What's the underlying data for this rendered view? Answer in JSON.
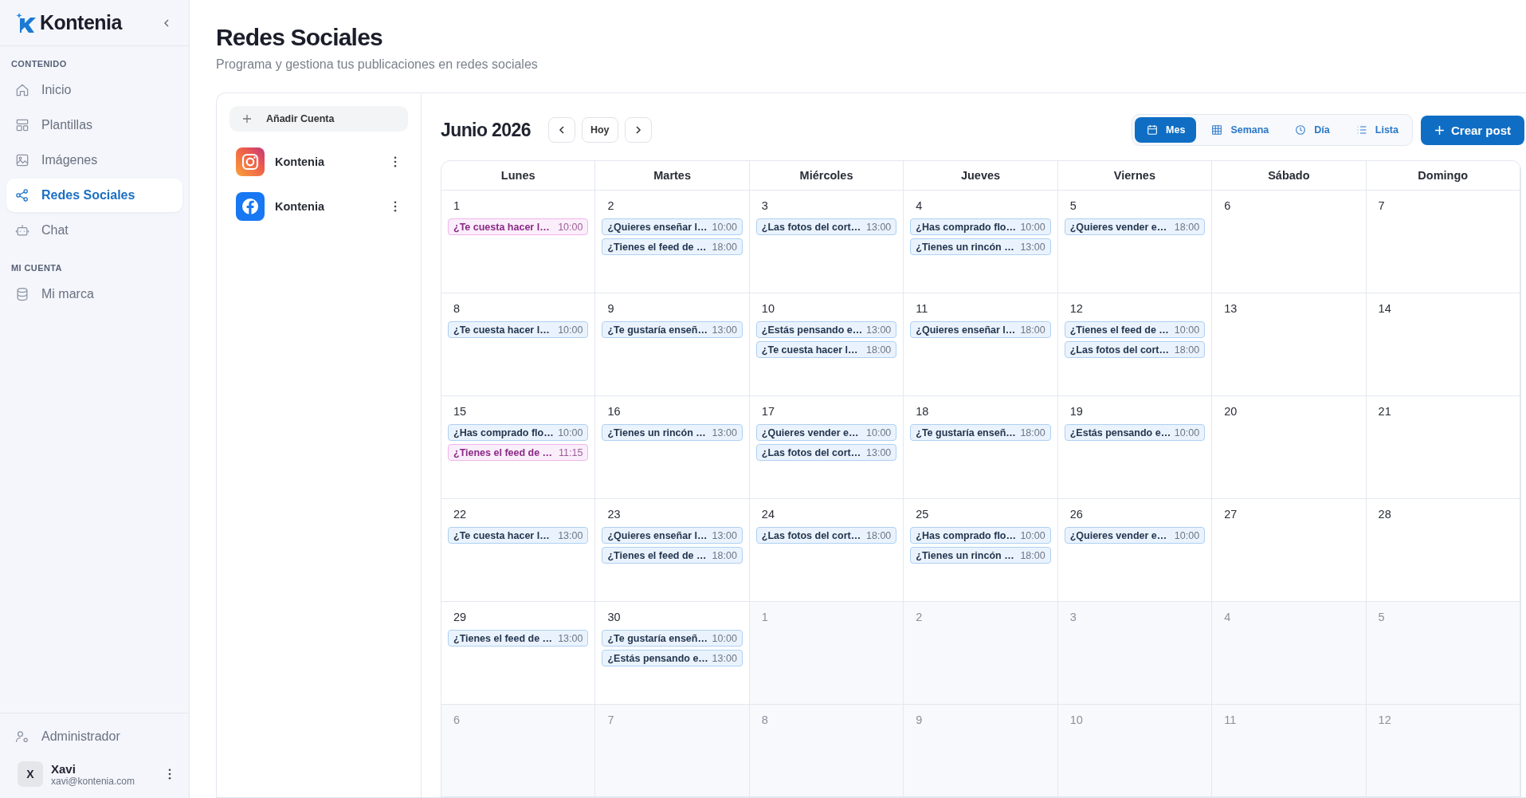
{
  "sidebar": {
    "brand": "Kontenia",
    "sections": [
      {
        "heading": "CONTENIDO",
        "items": [
          {
            "label": "Inicio",
            "selected": false
          },
          {
            "label": "Plantillas",
            "selected": false
          },
          {
            "label": "Imágenes",
            "selected": false
          },
          {
            "label": "Redes Sociales",
            "selected": true
          },
          {
            "label": "Chat",
            "selected": false
          }
        ]
      },
      {
        "heading": "MI CUENTA",
        "items": [
          {
            "label": "Mi marca",
            "selected": false
          }
        ]
      }
    ],
    "admin": "Administrador",
    "user": {
      "initial": "X",
      "name": "Xavi",
      "email": "xavi@kontenia.com"
    }
  },
  "page": {
    "title": "Redes Sociales",
    "subtitle": "Programa y gestiona tus publicaciones en redes sociales"
  },
  "accounts": {
    "add_label": "Añadir Cuenta",
    "items": [
      {
        "kind": "instagram",
        "name": "Kontenia"
      },
      {
        "kind": "facebook",
        "name": "Kontenia"
      }
    ]
  },
  "calendar": {
    "month": "Junio 2026",
    "today": "Hoy",
    "views": [
      {
        "label": "Mes",
        "selected": true
      },
      {
        "label": "Semana",
        "selected": false
      },
      {
        "label": "Día",
        "selected": false
      },
      {
        "label": "Lista",
        "selected": false
      }
    ],
    "create": "Crear post",
    "weekdays": [
      "Lunes",
      "Martes",
      "Miércoles",
      "Jueves",
      "Viernes",
      "Sábado",
      "Domingo"
    ],
    "weeks": [
      [
        {
          "day": "1",
          "other_month": false,
          "events": [
            {
              "title": "¿Te cuesta hacer l…",
              "time": "10:00",
              "kind": "instagram"
            }
          ]
        },
        {
          "day": "2",
          "other_month": false,
          "events": [
            {
              "title": "¿Quieres enseñar l…",
              "time": "10:00",
              "kind": "facebook"
            },
            {
              "title": "¿Tienes el feed de …",
              "time": "18:00",
              "kind": "facebook"
            }
          ]
        },
        {
          "day": "3",
          "other_month": false,
          "events": [
            {
              "title": "¿Las fotos del cort…",
              "time": "13:00",
              "kind": "facebook"
            }
          ]
        },
        {
          "day": "4",
          "other_month": false,
          "events": [
            {
              "title": "¿Has comprado flo…",
              "time": "10:00",
              "kind": "facebook"
            },
            {
              "title": "¿Tienes un rincón …",
              "time": "13:00",
              "kind": "facebook"
            }
          ]
        },
        {
          "day": "5",
          "other_month": false,
          "events": [
            {
              "title": "¿Quieres vender e…",
              "time": "18:00",
              "kind": "facebook"
            }
          ]
        },
        {
          "day": "6",
          "other_month": false
        },
        {
          "day": "7",
          "other_month": false
        }
      ],
      [
        {
          "day": "8",
          "other_month": false,
          "events": [
            {
              "title": "¿Te cuesta hacer l…",
              "time": "10:00",
              "kind": "facebook"
            }
          ]
        },
        {
          "day": "9",
          "other_month": false,
          "events": [
            {
              "title": "¿Te gustaría enseñ…",
              "time": "13:00",
              "kind": "facebook"
            }
          ]
        },
        {
          "day": "10",
          "other_month": false,
          "events": [
            {
              "title": "¿Estás pensando e…",
              "time": "13:00",
              "kind": "facebook"
            },
            {
              "title": "¿Te cuesta hacer l…",
              "time": "18:00",
              "kind": "facebook"
            }
          ]
        },
        {
          "day": "11",
          "other_month": false,
          "events": [
            {
              "title": "¿Quieres enseñar l…",
              "time": "18:00",
              "kind": "facebook"
            }
          ]
        },
        {
          "day": "12",
          "other_month": false,
          "events": [
            {
              "title": "¿Tienes el feed de …",
              "time": "10:00",
              "kind": "facebook"
            },
            {
              "title": "¿Las fotos del cort…",
              "time": "18:00",
              "kind": "facebook"
            }
          ]
        },
        {
          "day": "13",
          "other_month": false
        },
        {
          "day": "14",
          "other_month": false
        }
      ],
      [
        {
          "day": "15",
          "other_month": false,
          "events": [
            {
              "title": "¿Has comprado flo…",
              "time": "10:00",
              "kind": "facebook"
            },
            {
              "title": "¿Tienes el feed de …",
              "time": "11:15",
              "kind": "instagram"
            }
          ]
        },
        {
          "day": "16",
          "other_month": false,
          "events": [
            {
              "title": "¿Tienes un rincón …",
              "time": "13:00",
              "kind": "facebook"
            }
          ]
        },
        {
          "day": "17",
          "other_month": false,
          "events": [
            {
              "title": "¿Quieres vender e…",
              "time": "10:00",
              "kind": "facebook"
            },
            {
              "title": "¿Las fotos del cort…",
              "time": "13:00",
              "kind": "facebook"
            }
          ]
        },
        {
          "day": "18",
          "other_month": false,
          "events": [
            {
              "title": "¿Te gustaría enseñ…",
              "time": "18:00",
              "kind": "facebook"
            }
          ]
        },
        {
          "day": "19",
          "other_month": false,
          "events": [
            {
              "title": "¿Estás pensando e…",
              "time": "10:00",
              "kind": "facebook"
            }
          ]
        },
        {
          "day": "20",
          "other_month": false
        },
        {
          "day": "21",
          "other_month": false
        }
      ],
      [
        {
          "day": "22",
          "other_month": false,
          "events": [
            {
              "title": "¿Te cuesta hacer l…",
              "time": "13:00",
              "kind": "facebook"
            }
          ]
        },
        {
          "day": "23",
          "other_month": false,
          "events": [
            {
              "title": "¿Quieres enseñar l…",
              "time": "13:00",
              "kind": "facebook"
            },
            {
              "title": "¿Tienes el feed de …",
              "time": "18:00",
              "kind": "facebook"
            }
          ]
        },
        {
          "day": "24",
          "other_month": false,
          "events": [
            {
              "title": "¿Las fotos del cort…",
              "time": "18:00",
              "kind": "facebook"
            }
          ]
        },
        {
          "day": "25",
          "other_month": false,
          "events": [
            {
              "title": "¿Has comprado flo…",
              "time": "10:00",
              "kind": "facebook"
            },
            {
              "title": "¿Tienes un rincón …",
              "time": "18:00",
              "kind": "facebook"
            }
          ]
        },
        {
          "day": "26",
          "other_month": false,
          "events": [
            {
              "title": "¿Quieres vender e…",
              "time": "10:00",
              "kind": "facebook"
            }
          ]
        },
        {
          "day": "27",
          "other_month": false
        },
        {
          "day": "28",
          "other_month": false
        }
      ],
      [
        {
          "day": "29",
          "other_month": false,
          "events": [
            {
              "title": "¿Tienes el feed de …",
              "time": "13:00",
              "kind": "facebook"
            }
          ]
        },
        {
          "day": "30",
          "other_month": false,
          "events": [
            {
              "title": "¿Te gustaría enseñ…",
              "time": "10:00",
              "kind": "facebook"
            },
            {
              "title": "¿Estás pensando e…",
              "time": "13:00",
              "kind": "facebook"
            }
          ]
        },
        {
          "day": "1",
          "other_month": true
        },
        {
          "day": "2",
          "other_month": true
        },
        {
          "day": "3",
          "other_month": true
        },
        {
          "day": "4",
          "other_month": true
        },
        {
          "day": "5",
          "other_month": true
        }
      ],
      [
        {
          "day": "6",
          "other_month": true
        },
        {
          "day": "7",
          "other_month": true
        },
        {
          "day": "8",
          "other_month": true
        },
        {
          "day": "9",
          "other_month": true
        },
        {
          "day": "10",
          "other_month": true
        },
        {
          "day": "11",
          "other_month": true
        },
        {
          "day": "12",
          "other_month": true
        }
      ]
    ]
  }
}
